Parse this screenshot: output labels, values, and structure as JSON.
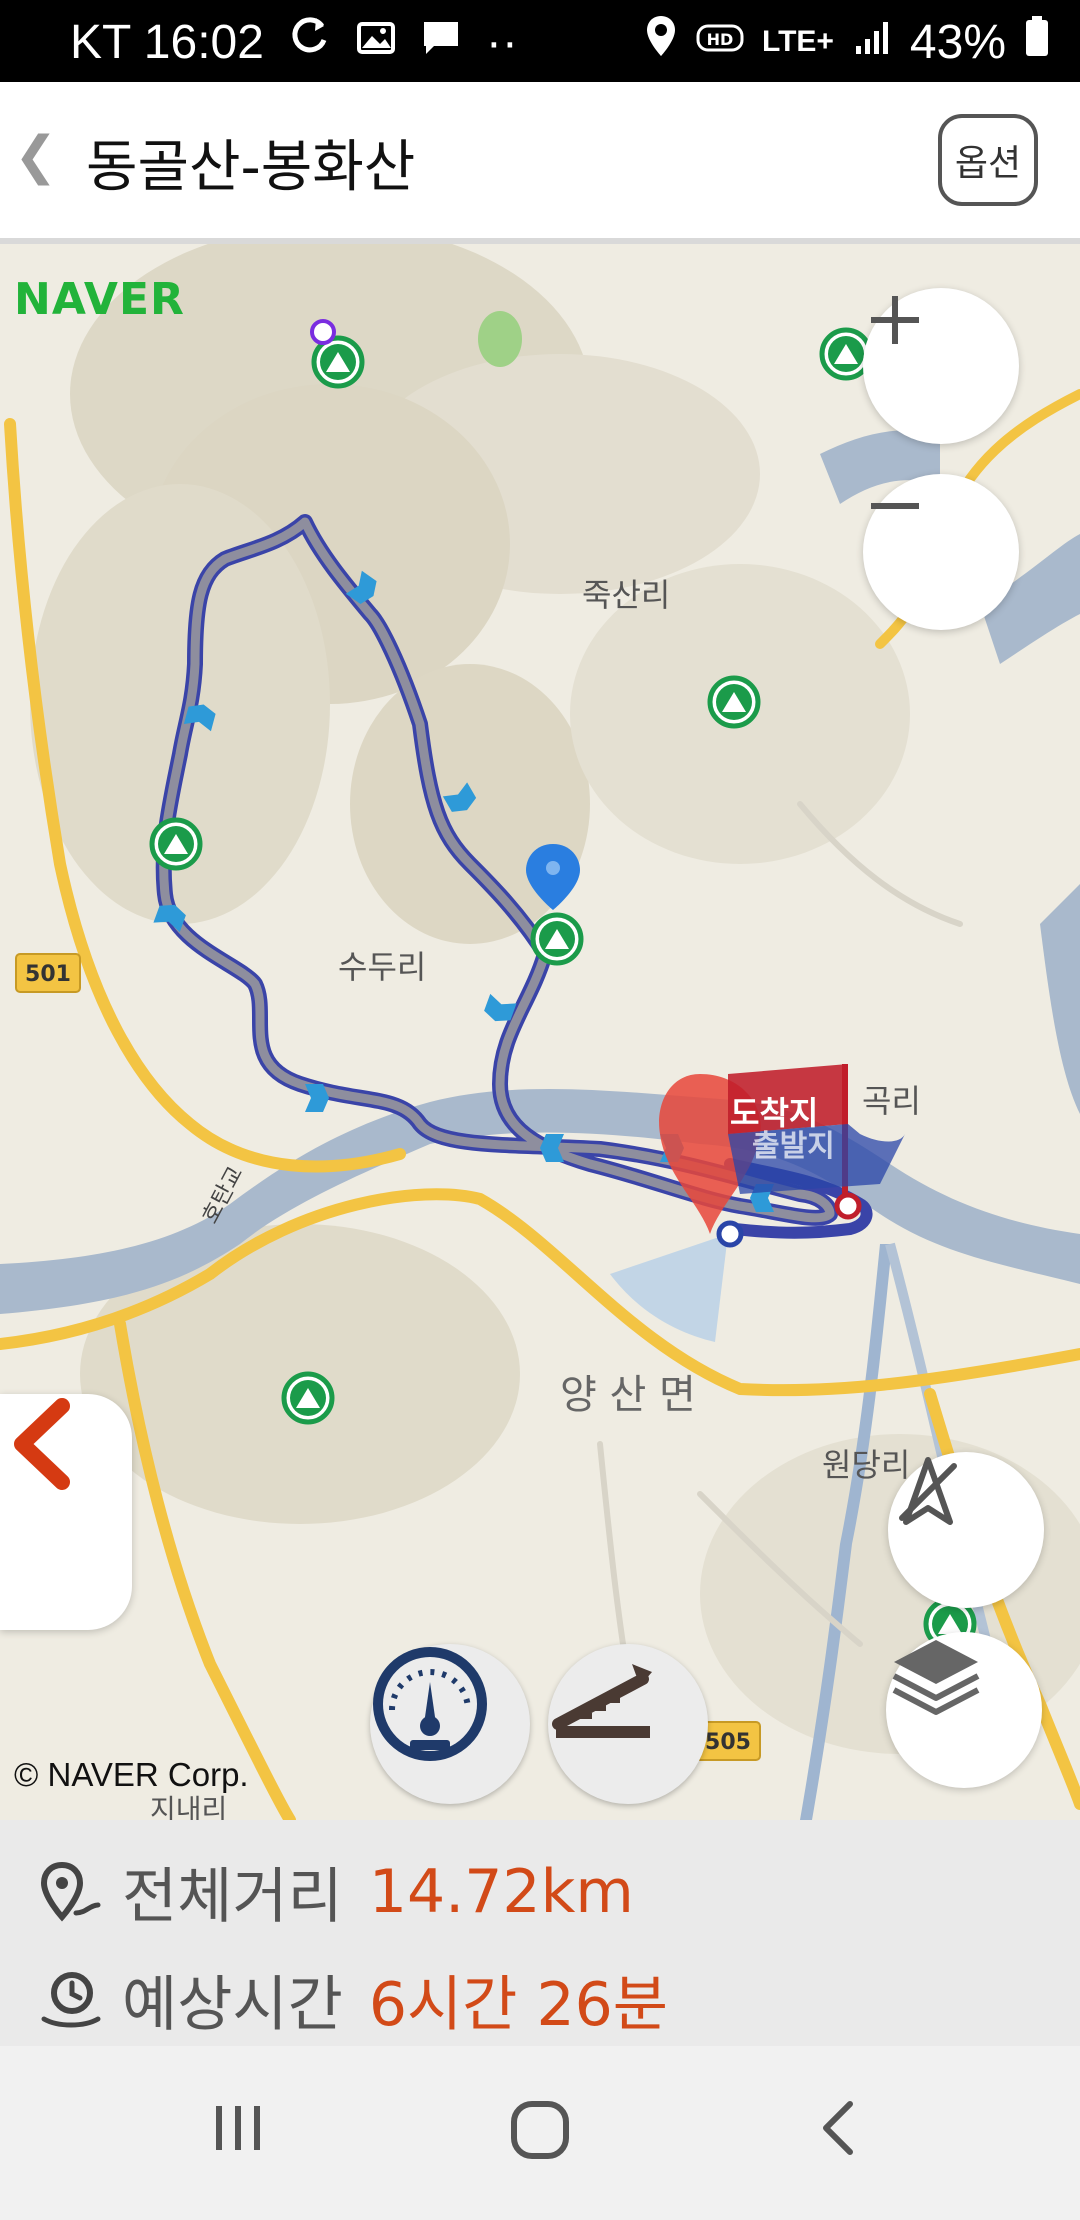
{
  "status_bar": {
    "carrier_time": "KT 16:02",
    "dots": "··",
    "network": "LTE+",
    "battery": "43%"
  },
  "header": {
    "title": "동골산-봉화산",
    "options_label": "옵션"
  },
  "map": {
    "logo": "NAVER",
    "copyright": "© NAVER Corp.",
    "labels": {
      "jugsan_ri": "죽산리",
      "suduri": "수두리",
      "yangsan_myeon": "양 산 면",
      "wondang_ri": "원당리",
      "gok_ri": "곡리",
      "arrival": "도착지",
      "departure": "출발지",
      "road_501": "501",
      "road_505": "505",
      "river_name": "호탄교",
      "jinae_ri": "지내리"
    },
    "accent_color": "#4a5fb8",
    "route_color": "#8e8e9e"
  },
  "info": {
    "distance_label": "전체거리",
    "distance_value": "14.72km",
    "time_label": "예상시간",
    "time_value": "6시간 26분",
    "value_color": "#d24a18"
  }
}
